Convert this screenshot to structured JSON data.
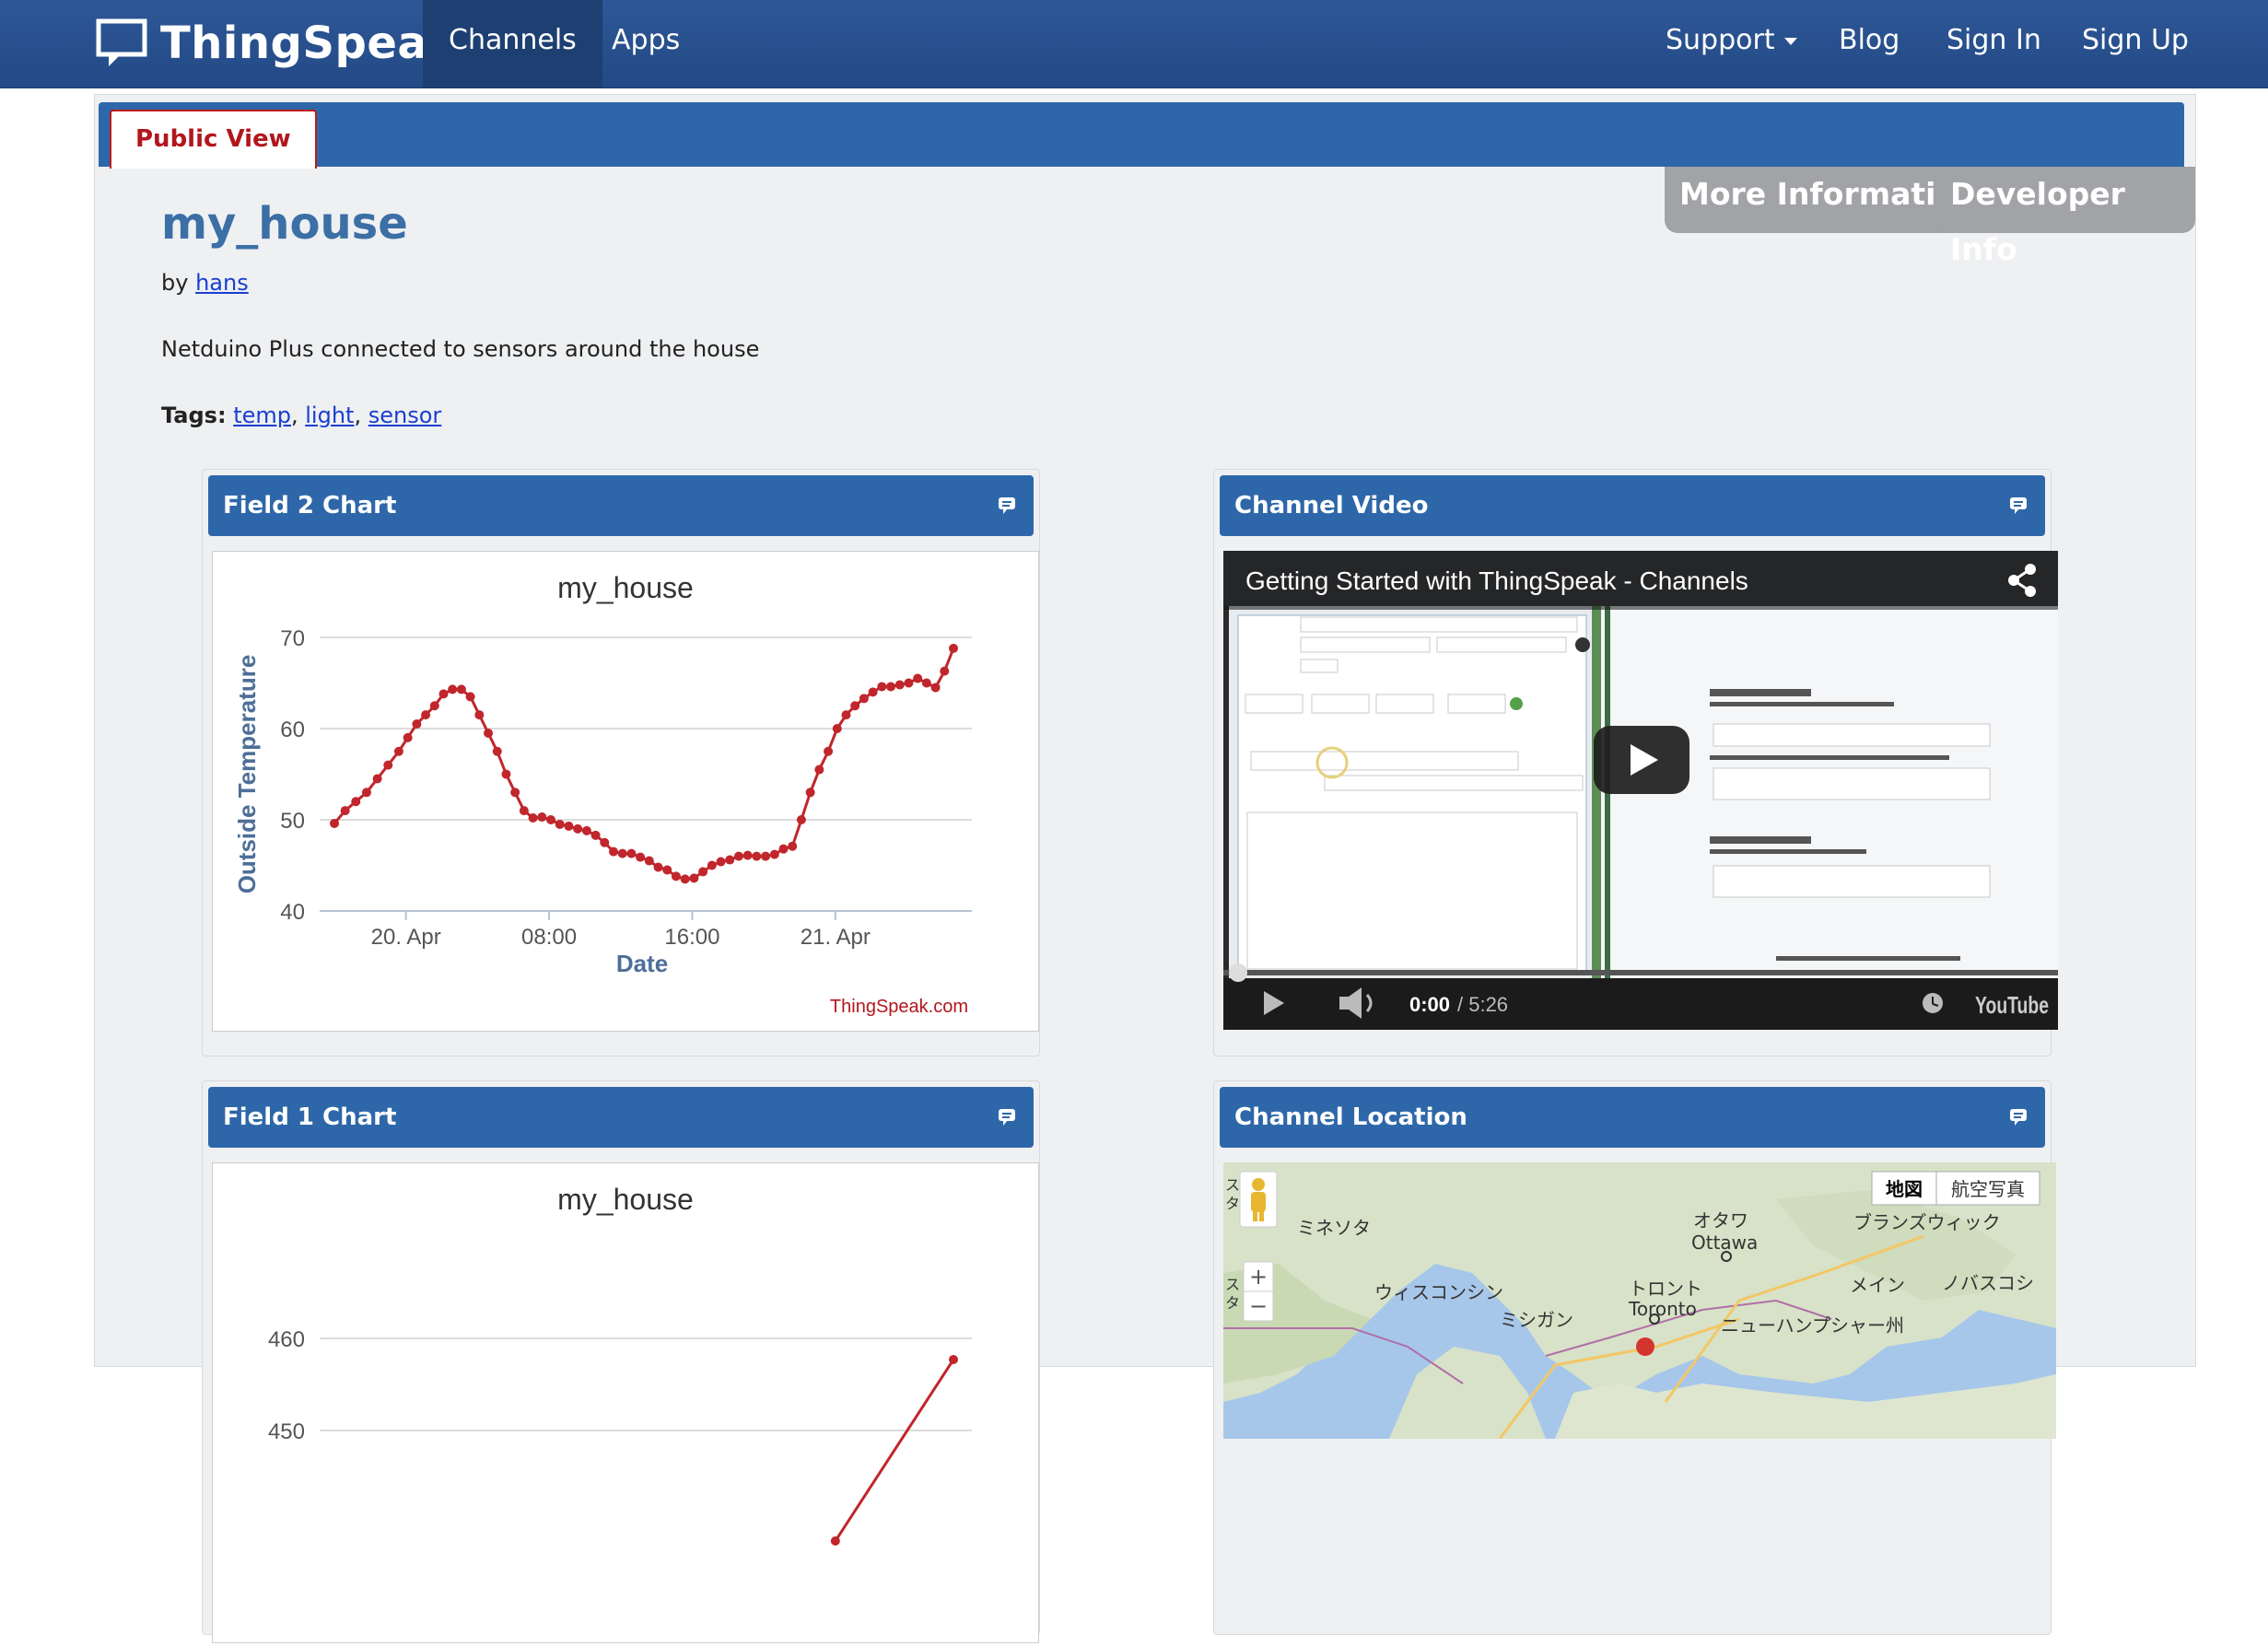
{
  "nav": {
    "brand": "ThingSpeak",
    "left_items": [
      {
        "label": "Channels",
        "active": true
      },
      {
        "label": "Apps",
        "active": false
      }
    ],
    "right_items": [
      {
        "label": "Support",
        "dropdown": true
      },
      {
        "label": "Blog"
      },
      {
        "label": "Sign In"
      },
      {
        "label": "Sign Up"
      }
    ]
  },
  "tabs": {
    "public_view": "Public View"
  },
  "buttons": {
    "more_information": "More Information",
    "developer_info": "Developer Info"
  },
  "channel": {
    "title": "my_house",
    "by_label": "by",
    "author": "hans",
    "description": "Netduino Plus connected to sensors around the house",
    "tags_label": "Tags:",
    "tags": [
      "temp",
      "light",
      "sensor"
    ]
  },
  "widgets": {
    "field2": {
      "title": "Field 2 Chart"
    },
    "video": {
      "title": "Channel Video"
    },
    "field1": {
      "title": "Field 1 Chart"
    },
    "location": {
      "title": "Channel Location"
    }
  },
  "chart_data": [
    {
      "type": "line",
      "title": "my_house",
      "xlabel": "Date",
      "ylabel": "Outside Temperature",
      "credit": "ThingSpeak.com",
      "ylim": [
        40,
        70
      ],
      "yticks": [
        40,
        50,
        60,
        70
      ],
      "xticks": [
        {
          "label": "20. Apr",
          "x": 4
        },
        {
          "label": "08:00",
          "x": 12
        },
        {
          "label": "16:00",
          "x": 20
        },
        {
          "label": "21. Apr",
          "x": 28
        }
      ],
      "xlim": [
        0,
        34.6
      ],
      "grid": true,
      "color": "#c0262c",
      "series": [
        {
          "values": [
            [
              0,
              49.6
            ],
            [
              0.6,
              51
            ],
            [
              1.2,
              52
            ],
            [
              1.8,
              53
            ],
            [
              2.4,
              54.5
            ],
            [
              3,
              56
            ],
            [
              3.6,
              57.5
            ],
            [
              4.1,
              59
            ],
            [
              4.6,
              60.5
            ],
            [
              5.1,
              61.5
            ],
            [
              5.6,
              62.5
            ],
            [
              6.1,
              63.8
            ],
            [
              6.6,
              64.3
            ],
            [
              7.1,
              64.3
            ],
            [
              7.6,
              63.5
            ],
            [
              8.1,
              61.5
            ],
            [
              8.6,
              59.5
            ],
            [
              9.1,
              57.5
            ],
            [
              9.6,
              55
            ],
            [
              10.1,
              53
            ],
            [
              10.6,
              51
            ],
            [
              11.1,
              50.2
            ],
            [
              11.6,
              50.3
            ],
            [
              12.1,
              50
            ],
            [
              12.6,
              49.5
            ],
            [
              13.1,
              49.3
            ],
            [
              13.6,
              49
            ],
            [
              14.1,
              48.8
            ],
            [
              14.6,
              48.3
            ],
            [
              15.1,
              47.5
            ],
            [
              15.6,
              46.5
            ],
            [
              16.1,
              46.3
            ],
            [
              16.6,
              46.3
            ],
            [
              17.1,
              45.9
            ],
            [
              17.6,
              45.5
            ],
            [
              18.1,
              44.8
            ],
            [
              18.6,
              44.5
            ],
            [
              19.1,
              43.8
            ],
            [
              19.6,
              43.5
            ],
            [
              20.1,
              43.6
            ],
            [
              20.6,
              44.3
            ],
            [
              21.1,
              45
            ],
            [
              21.6,
              45.4
            ],
            [
              22.1,
              45.6
            ],
            [
              22.6,
              46
            ],
            [
              23.1,
              46.1
            ],
            [
              23.6,
              46
            ],
            [
              24.1,
              46
            ],
            [
              24.6,
              46.2
            ],
            [
              25.1,
              46.8
            ],
            [
              25.6,
              47.1
            ],
            [
              26.1,
              50
            ],
            [
              26.6,
              53
            ],
            [
              27.1,
              55.5
            ],
            [
              27.6,
              57.5
            ],
            [
              28.1,
              60
            ],
            [
              28.6,
              61.5
            ],
            [
              29.1,
              62.5
            ],
            [
              29.6,
              63.3
            ],
            [
              30.1,
              64
            ],
            [
              30.6,
              64.6
            ],
            [
              31.1,
              64.6
            ],
            [
              31.6,
              64.8
            ],
            [
              32.1,
              65
            ],
            [
              32.6,
              65.5
            ],
            [
              33.1,
              65
            ],
            [
              33.6,
              64.5
            ],
            [
              34.1,
              66.3
            ],
            [
              34.6,
              68.8
            ]
          ]
        }
      ]
    },
    {
      "type": "line",
      "title": "my_house",
      "yticks": [
        450,
        460
      ],
      "ylim": [
        440,
        470
      ],
      "color": "#c0262c",
      "series": [
        {
          "values": [
            [
              28,
              438
            ],
            [
              34.6,
              457.7
            ]
          ]
        }
      ]
    }
  ],
  "video": {
    "title": "Getting Started with ThingSpeak - Channels",
    "time_current": "0:00",
    "time_total": "/ 5:26",
    "logo": "YouTube"
  },
  "map": {
    "map_button": "地図",
    "satellite_button": "航空写真",
    "zoom_in": "+",
    "zoom_out": "−",
    "pegman_label_1": "ス",
    "pegman_label_2": "タ",
    "labels": {
      "minnesota": "ミネソタ",
      "ottawa_jp": "オタワ",
      "ottawa": "Ottawa",
      "new_brunswick": "ブランズウィック",
      "wisconsin": "ウィスコンシン",
      "toronto_jp": "トロント",
      "toronto": "Toronto",
      "maine": "メイン",
      "nova_scotia": "ノバスコシ",
      "michigan": "ミシガン",
      "new_hampshire": "ニューハンプシャー州"
    }
  },
  "colors": {
    "nav_bg": "#2e5796",
    "accent_blue": "#2e67a9",
    "title_blue": "#3b6fa6",
    "tab_red": "#b2171c",
    "chart_line": "#c0262c",
    "button_gray": "#a1a3a6"
  },
  "icons": [
    "thingspeak-logo-icon",
    "caret-down-icon",
    "comment-icon",
    "share-icon",
    "play-icon",
    "volume-icon",
    "clock-icon",
    "pegman-icon"
  ]
}
